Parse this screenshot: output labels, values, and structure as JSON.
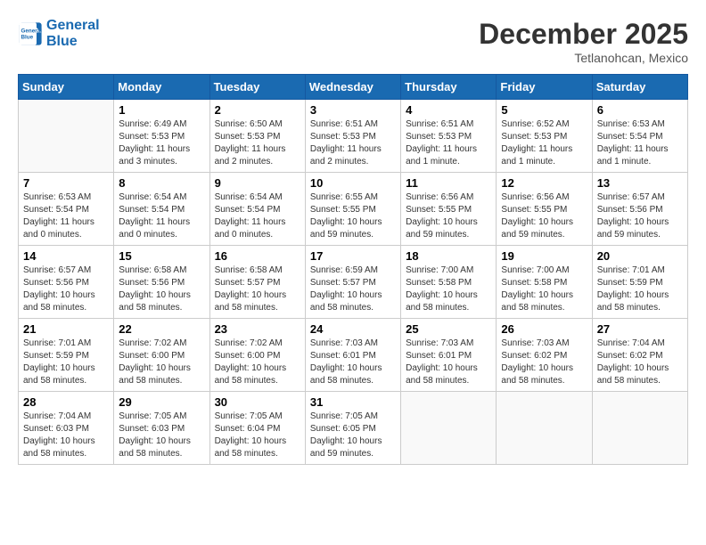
{
  "logo": {
    "line1": "General",
    "line2": "Blue"
  },
  "title": "December 2025",
  "location": "Tetlanohcan, Mexico",
  "days_header": [
    "Sunday",
    "Monday",
    "Tuesday",
    "Wednesday",
    "Thursday",
    "Friday",
    "Saturday"
  ],
  "weeks": [
    [
      {
        "num": "",
        "info": ""
      },
      {
        "num": "1",
        "info": "Sunrise: 6:49 AM\nSunset: 5:53 PM\nDaylight: 11 hours\nand 3 minutes."
      },
      {
        "num": "2",
        "info": "Sunrise: 6:50 AM\nSunset: 5:53 PM\nDaylight: 11 hours\nand 2 minutes."
      },
      {
        "num": "3",
        "info": "Sunrise: 6:51 AM\nSunset: 5:53 PM\nDaylight: 11 hours\nand 2 minutes."
      },
      {
        "num": "4",
        "info": "Sunrise: 6:51 AM\nSunset: 5:53 PM\nDaylight: 11 hours\nand 1 minute."
      },
      {
        "num": "5",
        "info": "Sunrise: 6:52 AM\nSunset: 5:53 PM\nDaylight: 11 hours\nand 1 minute."
      },
      {
        "num": "6",
        "info": "Sunrise: 6:53 AM\nSunset: 5:54 PM\nDaylight: 11 hours\nand 1 minute."
      }
    ],
    [
      {
        "num": "7",
        "info": "Sunrise: 6:53 AM\nSunset: 5:54 PM\nDaylight: 11 hours\nand 0 minutes."
      },
      {
        "num": "8",
        "info": "Sunrise: 6:54 AM\nSunset: 5:54 PM\nDaylight: 11 hours\nand 0 minutes."
      },
      {
        "num": "9",
        "info": "Sunrise: 6:54 AM\nSunset: 5:54 PM\nDaylight: 11 hours\nand 0 minutes."
      },
      {
        "num": "10",
        "info": "Sunrise: 6:55 AM\nSunset: 5:55 PM\nDaylight: 10 hours\nand 59 minutes."
      },
      {
        "num": "11",
        "info": "Sunrise: 6:56 AM\nSunset: 5:55 PM\nDaylight: 10 hours\nand 59 minutes."
      },
      {
        "num": "12",
        "info": "Sunrise: 6:56 AM\nSunset: 5:55 PM\nDaylight: 10 hours\nand 59 minutes."
      },
      {
        "num": "13",
        "info": "Sunrise: 6:57 AM\nSunset: 5:56 PM\nDaylight: 10 hours\nand 59 minutes."
      }
    ],
    [
      {
        "num": "14",
        "info": "Sunrise: 6:57 AM\nSunset: 5:56 PM\nDaylight: 10 hours\nand 58 minutes."
      },
      {
        "num": "15",
        "info": "Sunrise: 6:58 AM\nSunset: 5:56 PM\nDaylight: 10 hours\nand 58 minutes."
      },
      {
        "num": "16",
        "info": "Sunrise: 6:58 AM\nSunset: 5:57 PM\nDaylight: 10 hours\nand 58 minutes."
      },
      {
        "num": "17",
        "info": "Sunrise: 6:59 AM\nSunset: 5:57 PM\nDaylight: 10 hours\nand 58 minutes."
      },
      {
        "num": "18",
        "info": "Sunrise: 7:00 AM\nSunset: 5:58 PM\nDaylight: 10 hours\nand 58 minutes."
      },
      {
        "num": "19",
        "info": "Sunrise: 7:00 AM\nSunset: 5:58 PM\nDaylight: 10 hours\nand 58 minutes."
      },
      {
        "num": "20",
        "info": "Sunrise: 7:01 AM\nSunset: 5:59 PM\nDaylight: 10 hours\nand 58 minutes."
      }
    ],
    [
      {
        "num": "21",
        "info": "Sunrise: 7:01 AM\nSunset: 5:59 PM\nDaylight: 10 hours\nand 58 minutes."
      },
      {
        "num": "22",
        "info": "Sunrise: 7:02 AM\nSunset: 6:00 PM\nDaylight: 10 hours\nand 58 minutes."
      },
      {
        "num": "23",
        "info": "Sunrise: 7:02 AM\nSunset: 6:00 PM\nDaylight: 10 hours\nand 58 minutes."
      },
      {
        "num": "24",
        "info": "Sunrise: 7:03 AM\nSunset: 6:01 PM\nDaylight: 10 hours\nand 58 minutes."
      },
      {
        "num": "25",
        "info": "Sunrise: 7:03 AM\nSunset: 6:01 PM\nDaylight: 10 hours\nand 58 minutes."
      },
      {
        "num": "26",
        "info": "Sunrise: 7:03 AM\nSunset: 6:02 PM\nDaylight: 10 hours\nand 58 minutes."
      },
      {
        "num": "27",
        "info": "Sunrise: 7:04 AM\nSunset: 6:02 PM\nDaylight: 10 hours\nand 58 minutes."
      }
    ],
    [
      {
        "num": "28",
        "info": "Sunrise: 7:04 AM\nSunset: 6:03 PM\nDaylight: 10 hours\nand 58 minutes."
      },
      {
        "num": "29",
        "info": "Sunrise: 7:05 AM\nSunset: 6:03 PM\nDaylight: 10 hours\nand 58 minutes."
      },
      {
        "num": "30",
        "info": "Sunrise: 7:05 AM\nSunset: 6:04 PM\nDaylight: 10 hours\nand 58 minutes."
      },
      {
        "num": "31",
        "info": "Sunrise: 7:05 AM\nSunset: 6:05 PM\nDaylight: 10 hours\nand 59 minutes."
      },
      {
        "num": "",
        "info": ""
      },
      {
        "num": "",
        "info": ""
      },
      {
        "num": "",
        "info": ""
      }
    ]
  ]
}
